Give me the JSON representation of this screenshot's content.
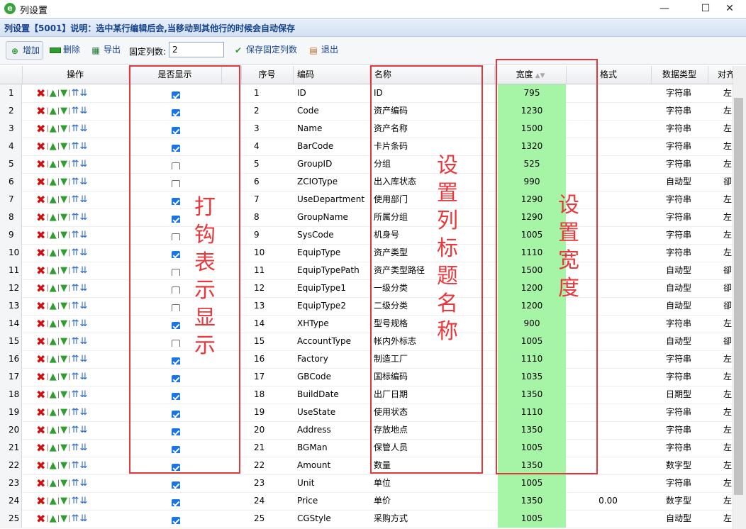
{
  "window": {
    "title": "列设置",
    "minimize": "—",
    "maximize": "☐",
    "close": "✕"
  },
  "info": "列设置【5001】说明：选中某行编辑后会,当移动到其他行的时候会自动保存",
  "toolbar": {
    "add": "增加",
    "delete": "删除",
    "export": "导出",
    "fixed_label": "固定列数:",
    "fixed_value": "2",
    "save_fixed": "保存固定列数",
    "exit": "退出"
  },
  "headers": {
    "ops": "操作",
    "show": "是否显示",
    "seq": "序号",
    "code": "编码",
    "name": "名称",
    "width": "宽度",
    "format": "格式",
    "dtype": "数据类型",
    "align": "对齐方"
  },
  "rows": [
    {
      "n": "1",
      "show": true,
      "seq": "1",
      "code": "ID",
      "name": "ID",
      "width": "795",
      "fmt": "",
      "dtype": "字符串",
      "align": "左"
    },
    {
      "n": "2",
      "show": true,
      "seq": "2",
      "code": "Code",
      "name": "资产编码",
      "width": "1230",
      "fmt": "",
      "dtype": "字符串",
      "align": "左"
    },
    {
      "n": "3",
      "show": true,
      "seq": "3",
      "code": "Name",
      "name": "资产名称",
      "width": "1500",
      "fmt": "",
      "dtype": "字符串",
      "align": "左"
    },
    {
      "n": "4",
      "show": true,
      "seq": "4",
      "code": "BarCode",
      "name": "卡片条码",
      "width": "1320",
      "fmt": "",
      "dtype": "字符串",
      "align": "左"
    },
    {
      "n": "5",
      "show": false,
      "seq": "5",
      "code": "GroupID",
      "name": "分组",
      "width": "525",
      "fmt": "",
      "dtype": "字符串",
      "align": "左"
    },
    {
      "n": "6",
      "show": false,
      "seq": "6",
      "code": "ZCIOType",
      "name": "出入库状态",
      "width": "990",
      "fmt": "",
      "dtype": "自动型",
      "align": "卻"
    },
    {
      "n": "7",
      "show": true,
      "seq": "7",
      "code": "UseDepartment",
      "name": "使用部门",
      "width": "1290",
      "fmt": "",
      "dtype": "字符串",
      "align": "左"
    },
    {
      "n": "8",
      "show": true,
      "seq": "8",
      "code": "GroupName",
      "name": "所属分组",
      "width": "1290",
      "fmt": "",
      "dtype": "字符串",
      "align": "左"
    },
    {
      "n": "9",
      "show": false,
      "seq": "9",
      "code": "SysCode",
      "name": "机身号",
      "width": "1005",
      "fmt": "",
      "dtype": "字符串",
      "align": "左"
    },
    {
      "n": "10",
      "show": true,
      "seq": "10",
      "code": "EquipType",
      "name": "资产类型",
      "width": "1110",
      "fmt": "",
      "dtype": "字符串",
      "align": "左"
    },
    {
      "n": "11",
      "show": false,
      "seq": "11",
      "code": "EquipTypePath",
      "name": "资产类型路径",
      "width": "1500",
      "fmt": "",
      "dtype": "自动型",
      "align": "卻"
    },
    {
      "n": "12",
      "show": false,
      "seq": "12",
      "code": "EquipType1",
      "name": "一级分类",
      "width": "1200",
      "fmt": "",
      "dtype": "自动型",
      "align": "卻"
    },
    {
      "n": "13",
      "show": false,
      "seq": "13",
      "code": "EquipType2",
      "name": "二级分类",
      "width": "1200",
      "fmt": "",
      "dtype": "自动型",
      "align": "卻"
    },
    {
      "n": "14",
      "show": true,
      "seq": "14",
      "code": "XHType",
      "name": "型号规格",
      "width": "900",
      "fmt": "",
      "dtype": "字符串",
      "align": "左"
    },
    {
      "n": "15",
      "show": false,
      "seq": "15",
      "code": "AccountType",
      "name": "帐内外标志",
      "width": "1005",
      "fmt": "",
      "dtype": "自动型",
      "align": "卻"
    },
    {
      "n": "16",
      "show": true,
      "seq": "16",
      "code": "Factory",
      "name": "制造工厂",
      "width": "1110",
      "fmt": "",
      "dtype": "字符串",
      "align": "左"
    },
    {
      "n": "17",
      "show": true,
      "seq": "17",
      "code": "GBCode",
      "name": "国标编码",
      "width": "1035",
      "fmt": "",
      "dtype": "字符串",
      "align": "左"
    },
    {
      "n": "18",
      "show": true,
      "seq": "18",
      "code": "BuildDate",
      "name": "出厂日期",
      "width": "1350",
      "fmt": "",
      "dtype": "日期型",
      "align": "左"
    },
    {
      "n": "19",
      "show": true,
      "seq": "19",
      "code": "UseState",
      "name": "使用状态",
      "width": "1110",
      "fmt": "",
      "dtype": "字符串",
      "align": "左"
    },
    {
      "n": "20",
      "show": true,
      "seq": "20",
      "code": "Address",
      "name": "存放地点",
      "width": "1350",
      "fmt": "",
      "dtype": "字符串",
      "align": "左"
    },
    {
      "n": "21",
      "show": true,
      "seq": "21",
      "code": "BGMan",
      "name": "保管人员",
      "width": "1005",
      "fmt": "",
      "dtype": "字符串",
      "align": "左"
    },
    {
      "n": "22",
      "show": true,
      "seq": "22",
      "code": "Amount",
      "name": "数量",
      "width": "1350",
      "fmt": "",
      "dtype": "数字型",
      "align": "左"
    },
    {
      "n": "23",
      "show": true,
      "seq": "23",
      "code": "Unit",
      "name": "单位",
      "width": "1005",
      "fmt": "",
      "dtype": "字符串",
      "align": "左"
    },
    {
      "n": "24",
      "show": true,
      "seq": "24",
      "code": "Price",
      "name": "单价",
      "width": "1350",
      "fmt": "0.00",
      "dtype": "数字型",
      "align": "左"
    },
    {
      "n": "25",
      "show": true,
      "seq": "25",
      "code": "CGStyle",
      "name": "采购方式",
      "width": "1005",
      "fmt": "",
      "dtype": "自动型",
      "align": "左"
    }
  ],
  "annotations": {
    "show": [
      "打",
      "钩",
      "表",
      "示",
      "显",
      "示"
    ],
    "name": [
      "设",
      "置",
      "列",
      "标",
      "题",
      "名",
      "称"
    ],
    "width": [
      "设",
      "置",
      "宽",
      "度"
    ]
  },
  "colors": {
    "width_cell": "#a6f4a6",
    "annotation": "#e8383b",
    "info_text": "#15428b"
  }
}
